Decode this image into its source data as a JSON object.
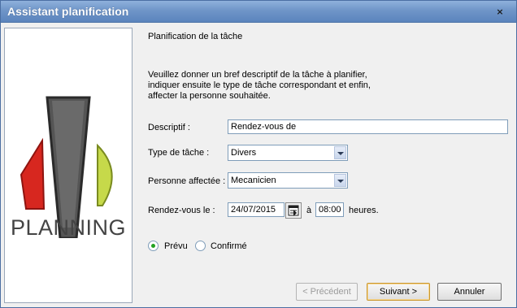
{
  "window": {
    "title": "Assistant planification",
    "close_label": "×"
  },
  "logo": {
    "text": "PLANNING"
  },
  "header": {
    "step_title": "Planification de la tâche"
  },
  "instructions": [
    "Veuillez donner un bref descriptif de la tâche à planifier,",
    "indiquer ensuite le type de tâche correspondant et enfin,",
    "affecter la personne souhaitée."
  ],
  "form": {
    "descriptif": {
      "label": "Descriptif :",
      "value": "Rendez-vous de"
    },
    "type_tache": {
      "label": "Type de tâche :",
      "value": "Divers"
    },
    "personne": {
      "label": "Personne affectée :",
      "value": "Mecanicien"
    },
    "rdv": {
      "label": "Rendez-vous le :",
      "date": "24/07/2015",
      "a_label": "à",
      "time": "08:00",
      "heures_label": "heures."
    },
    "status": {
      "prevu_label": "Prévu",
      "confirme_label": "Confirmé",
      "selected": "Prévu"
    }
  },
  "buttons": {
    "prev": "< Précédent",
    "next": "Suivant >",
    "cancel": "Annuler"
  },
  "colors": {
    "title_bar": "#6f95c8",
    "radio_selected": "#21a121",
    "default_button_border": "#c9972f"
  }
}
